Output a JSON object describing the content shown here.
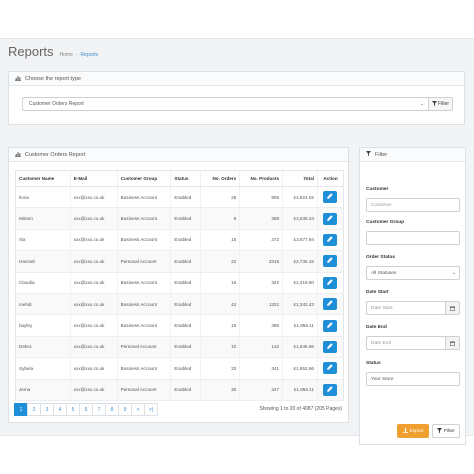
{
  "header": {
    "title": "Reports",
    "breadcrumb": [
      "Home",
      "Reports"
    ]
  },
  "choose_panel": {
    "heading": "Choose the report type",
    "selected_report": "Customer Orders Report",
    "filter_button": "Filter"
  },
  "report_panel": {
    "heading": "Customer Orders Report",
    "columns": [
      "Customer Name",
      "E-Mail",
      "Customer Group",
      "Status",
      "No. Orders",
      "No. Products",
      "Total",
      "Action"
    ],
    "rows": [
      [
        "Ilona",
        "xxx@xxx.co.uk",
        "Business Account",
        "Enabled",
        "28",
        "906",
        "£4,824.02"
      ],
      [
        "Miriam",
        "xxx@xxx.co.uk",
        "Business Account",
        "Enabled",
        "9",
        "398",
        "£3,639.24"
      ],
      [
        "rita",
        "xxx@xxx.co.uk",
        "Business Account",
        "Enabled",
        "15",
        "372",
        "£3,677.94"
      ],
      [
        "Hannah",
        "xxx@xxx.co.uk",
        "Personal Account",
        "Enabled",
        "22",
        "3318",
        "£2,736.15"
      ],
      [
        "Claudia",
        "xxx@xxx.co.uk",
        "Business Account",
        "Enabled",
        "16",
        "322",
        "£2,319.80"
      ],
      [
        "mehdi",
        "xxx@xxx.co.uk",
        "Business Account",
        "Enabled",
        "42",
        "1322",
        "£2,342.43"
      ],
      [
        "hayley",
        "xxx@xxx.co.uk",
        "Business Account",
        "Enabled",
        "15",
        "495",
        "£1,956.11"
      ],
      [
        "Debra",
        "xxx@xxx.co.uk",
        "Personal Account",
        "Enabled",
        "10",
        "142",
        "£1,946.66"
      ],
      [
        "Sybela",
        "xxx@xxx.co.uk",
        "Business Account",
        "Enabled",
        "33",
        "341",
        "£1,952.66"
      ],
      [
        "Jema",
        "xxx@xxx.co.uk",
        "Personal Account",
        "Enabled",
        "30",
        "347",
        "£1,956.11"
      ]
    ],
    "pagination": [
      "1",
      "2",
      "3",
      "4",
      "5",
      "6",
      "7",
      "8",
      "9",
      ">",
      ">|"
    ],
    "active_page": "1",
    "info": "Showing 1 to 20 of 4087 (205 Pages)"
  },
  "filter_panel": {
    "heading": "Filter",
    "customer_label": "Customer",
    "customer_placeholder": "Customer",
    "group_label": "Customer Group",
    "group_value": "",
    "status_label": "Order Status",
    "status_value": "All Statuses",
    "date_start_label": "Date Start",
    "date_start_placeholder": "Date Start",
    "date_end_label": "Date End",
    "date_end_placeholder": "Date End",
    "store_label": "Status",
    "store_value": "Your Store",
    "export_button": "Export",
    "filter_button": "Filter"
  },
  "icons": {
    "chart": "bar-chart-icon",
    "filter": "filter-icon",
    "edit": "pencil-icon",
    "calendar": "calendar-icon",
    "export": "download-icon"
  },
  "colors": {
    "primary": "#1f8fd8",
    "export": "#f0a030"
  }
}
